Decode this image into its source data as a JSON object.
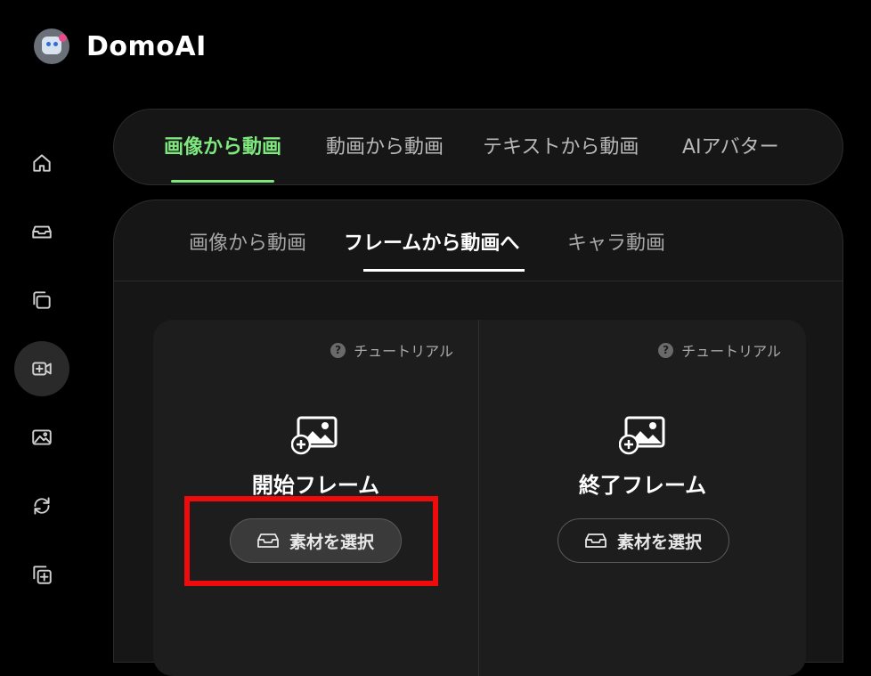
{
  "brand": {
    "name": "DomoAI"
  },
  "sidebar": {
    "items": [
      {
        "icon": "home-icon"
      },
      {
        "icon": "inbox-icon"
      },
      {
        "icon": "copy-icon"
      },
      {
        "icon": "video-add-icon",
        "active": true
      },
      {
        "icon": "image-icon"
      },
      {
        "icon": "refresh-icon"
      },
      {
        "icon": "layers-add-icon"
      }
    ]
  },
  "top_tabs": [
    {
      "label": "画像から動画",
      "active": true
    },
    {
      "label": "動画から動画"
    },
    {
      "label": "テキストから動画"
    },
    {
      "label": "AIアバター"
    }
  ],
  "sub_tabs": [
    {
      "label": "画像から動画"
    },
    {
      "label": "フレームから動画へ",
      "active": true
    },
    {
      "label": "キャラ動画"
    }
  ],
  "frames": {
    "start": {
      "tutorial": "チュートリアル",
      "title": "開始フレーム",
      "button": "素材を選択"
    },
    "end": {
      "tutorial": "チュートリアル",
      "title": "終了フレーム",
      "button": "素材を選択"
    }
  },
  "colors": {
    "accent": "#7ee87e",
    "highlight": "#ef0b0b",
    "background": "#000000",
    "panel": "#161616"
  }
}
